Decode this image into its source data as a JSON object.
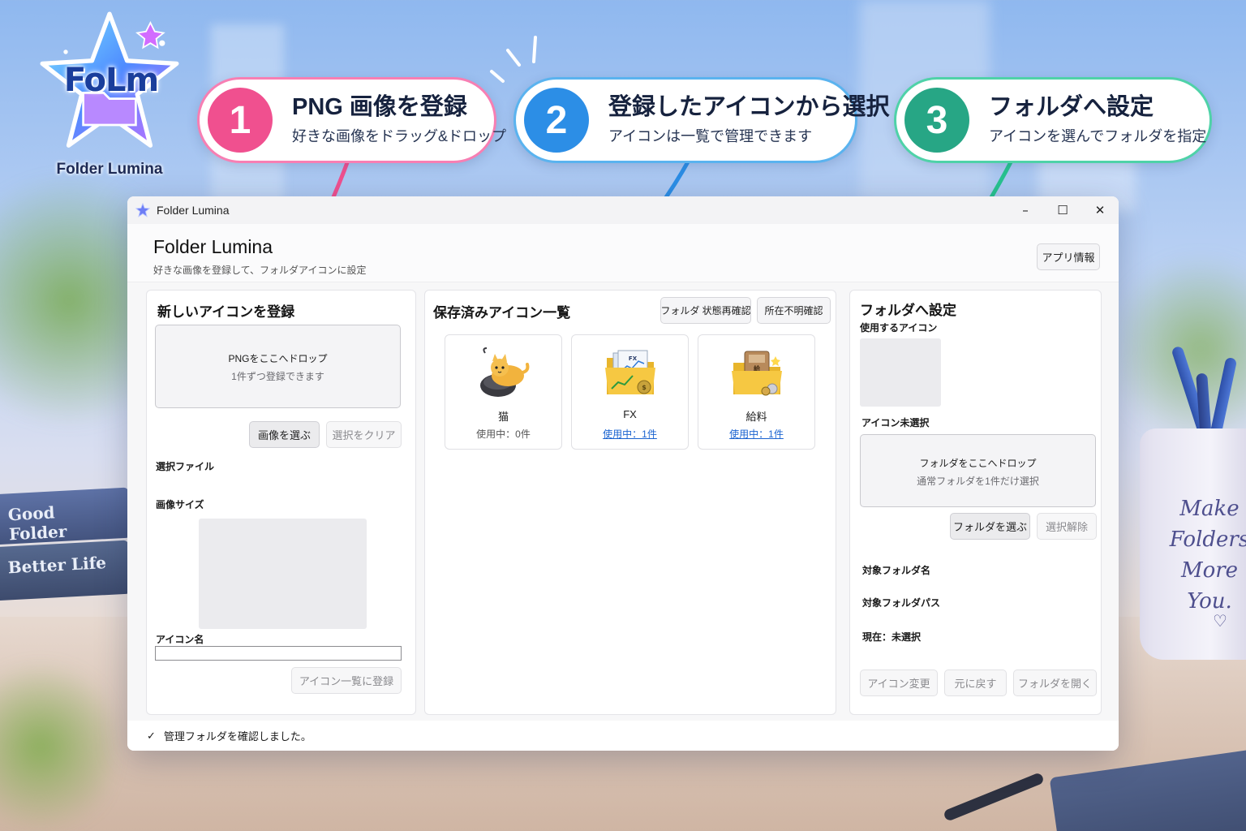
{
  "logo": {
    "wordmark": "FoLm",
    "name": "Folder Lumina"
  },
  "callouts": [
    {
      "number": "1",
      "title": "PNG 画像を登録",
      "subtitle": "好きな画像をドラッグ&ドロップ",
      "color": "#f0508f"
    },
    {
      "number": "2",
      "title": "登録したアイコンから選択",
      "subtitle": "アイコンは一覧で管理できます",
      "color": "#2c8ee6"
    },
    {
      "number": "3",
      "title": "フォルダへ設定",
      "subtitle": "アイコンを選んでフォルダを指定",
      "color": "#27a685"
    }
  ],
  "window": {
    "title": "Folder Lumina",
    "controls": {
      "minimize": "–",
      "maximize": "☐",
      "close": "✕"
    }
  },
  "header": {
    "title": "Folder Lumina",
    "subtitle": "好きな画像を登録して、フォルダアイコンに設定",
    "app_info_button": "アプリ情報"
  },
  "register_panel": {
    "title": "新しいアイコンを登録",
    "dropzone_line1": "PNGをここへドロップ",
    "dropzone_line2": "1件ずつ登録できます",
    "choose_image_button": "画像を選ぶ",
    "clear_selection_button": "選択をクリア",
    "selected_file_label": "選択ファイル",
    "image_size_label": "画像サイズ",
    "icon_name_label": "アイコン名",
    "icon_name_value": "",
    "register_button": "アイコン一覧に登録"
  },
  "saved_panel": {
    "title": "保存済みアイコン一覧",
    "recheck_button": "フォルダ 状態再確認",
    "missing_check_button": "所在不明確認",
    "icons": [
      {
        "name": "猫",
        "usage": "使用中：0件",
        "linked": false,
        "art": "cat-icon"
      },
      {
        "name": "FX",
        "usage": "使用中：1件",
        "linked": true,
        "art": "fx-folder-icon"
      },
      {
        "name": "給料",
        "usage": "使用中：1件",
        "linked": true,
        "art": "salary-folder-icon"
      }
    ]
  },
  "folder_panel": {
    "title": "フォルダへ設定",
    "use_icon_label": "使用するアイコン",
    "icon_status": "アイコン未選択",
    "dropzone_line1": "フォルダをここへドロップ",
    "dropzone_line2": "通常フォルダを1件だけ選択",
    "choose_folder_button": "フォルダを選ぶ",
    "deselect_button": "選択解除",
    "target_folder_name_label": "対象フォルダ名",
    "target_folder_path_label": "対象フォルダパス",
    "current_label": "現在：未選択",
    "change_icon_button": "アイコン変更",
    "revert_button": "元に戻す",
    "open_folder_button": "フォルダを開く"
  },
  "status_bar": {
    "check": "✓",
    "message": "管理フォルダを確認しました。"
  },
  "background": {
    "book_1": "Good Folder",
    "book_2": "Better Life",
    "mug_text": "Make\nFolders\nMore\nYou.",
    "mug_heart": "♡"
  }
}
